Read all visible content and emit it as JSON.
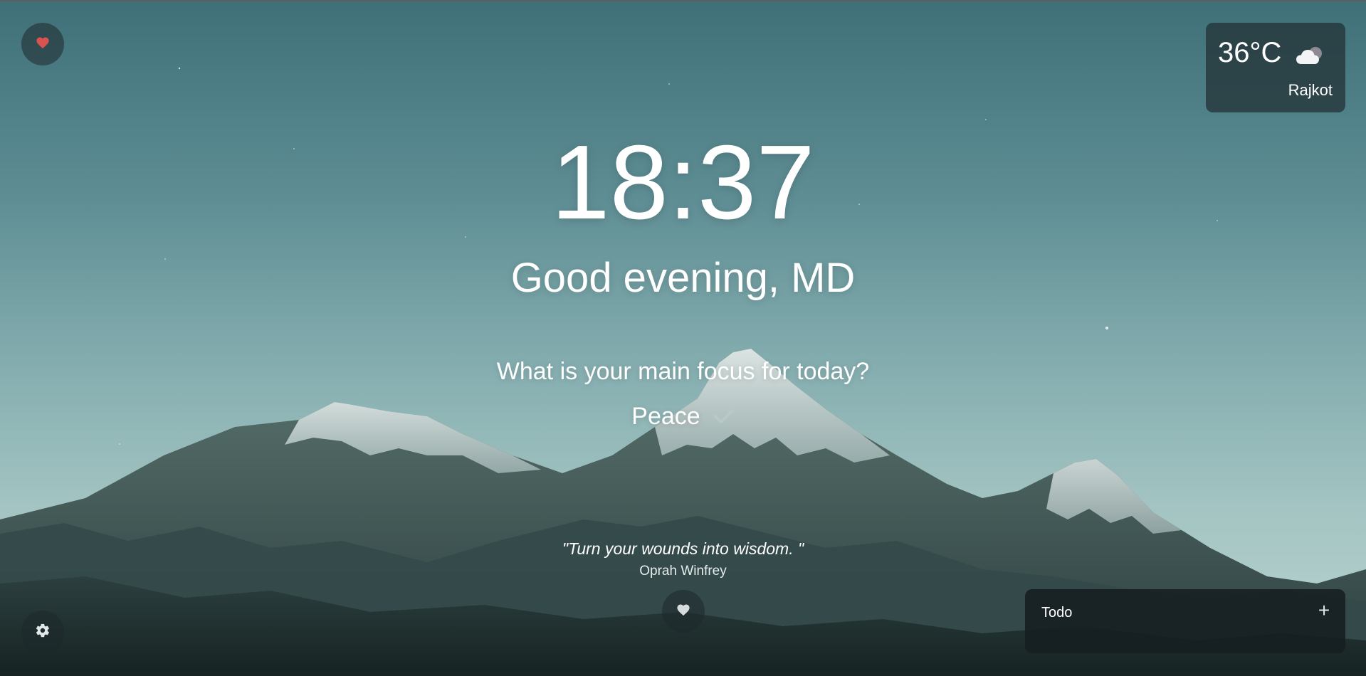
{
  "clock": {
    "time": "18:37"
  },
  "greeting": {
    "text": "Good evening, MD"
  },
  "focus": {
    "question": "What is your main focus for today?",
    "value": "Peace"
  },
  "weather": {
    "temperature": "36°C",
    "city": "Rajkot",
    "icon": "cloud-icon"
  },
  "quote": {
    "text": "\"Turn your wounds into wisdom. \"",
    "author": "Oprah Winfrey"
  },
  "todo": {
    "title": "Todo",
    "add_label": "+"
  },
  "icons": {
    "favorite": "heart-icon",
    "settings": "gear-icon",
    "quote_like": "heart-icon",
    "focus_done": "check-icon"
  },
  "colors": {
    "heart_active": "#d9534f",
    "heart_inactive": "#d6dcdd"
  }
}
